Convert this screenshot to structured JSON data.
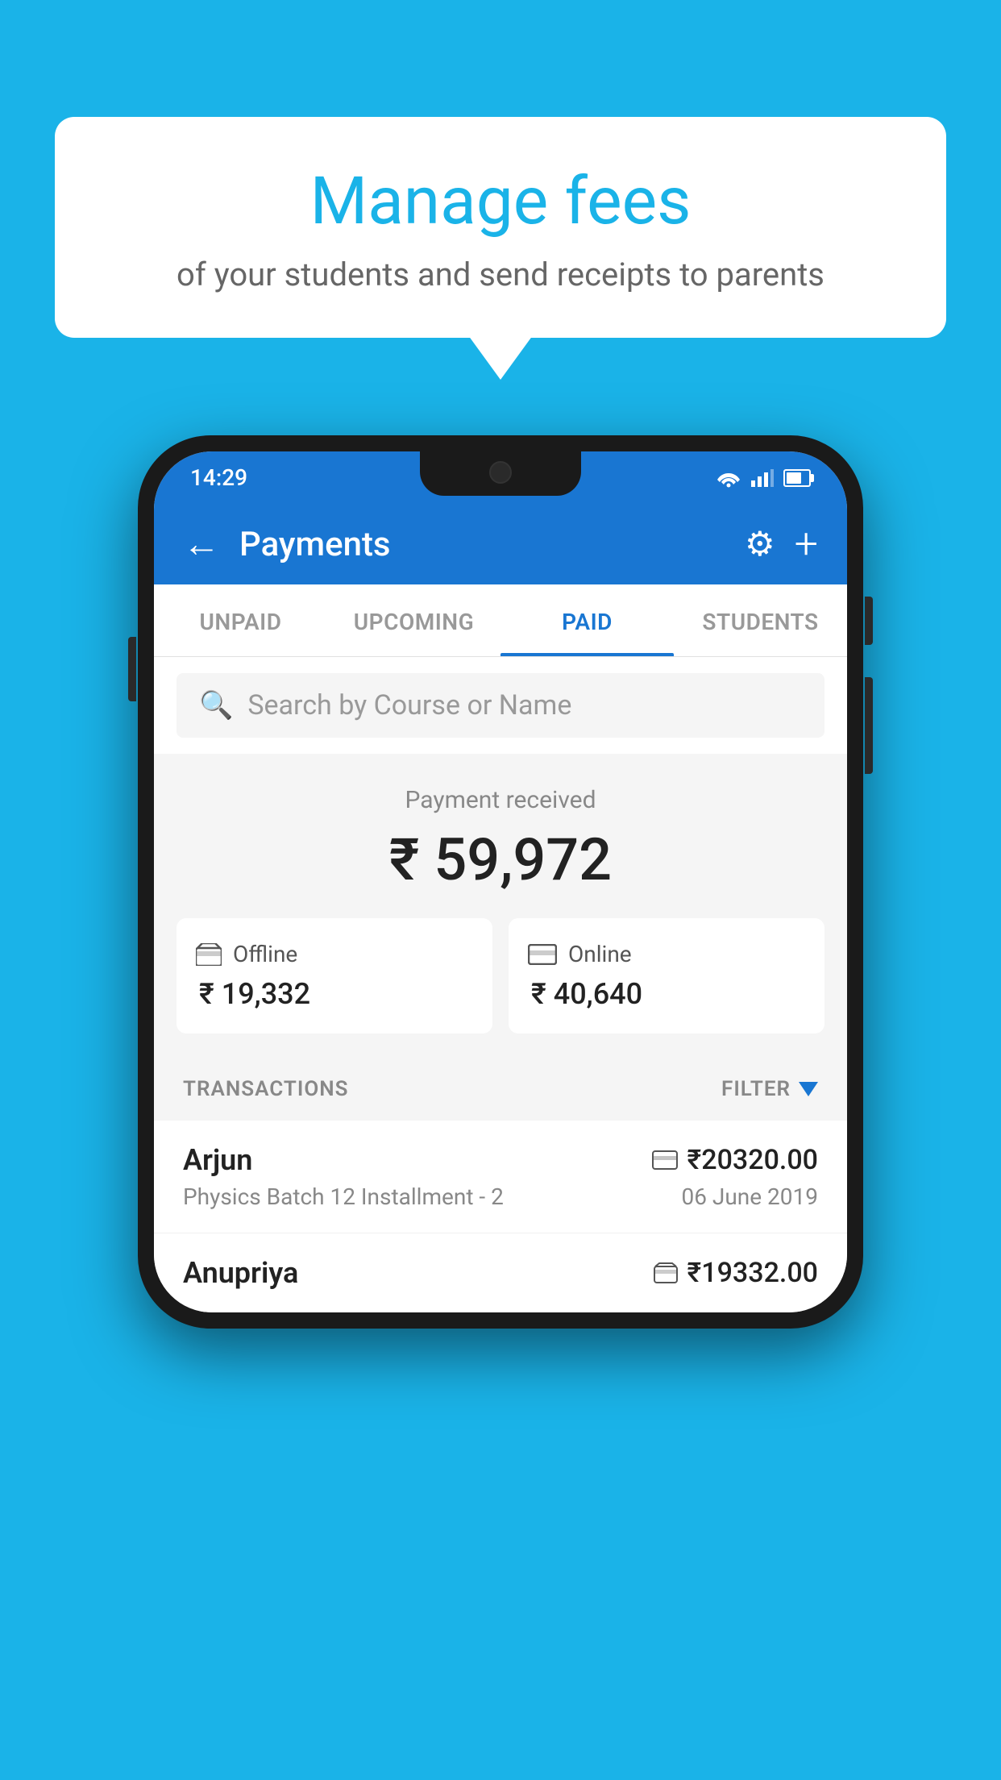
{
  "background_color": "#1ab3e8",
  "bubble": {
    "title": "Manage fees",
    "subtitle": "of your students and send receipts to parents"
  },
  "status_bar": {
    "time": "14:29",
    "wifi": "wifi",
    "signal": "signal",
    "battery": "battery"
  },
  "header": {
    "title": "Payments",
    "back_label": "←",
    "settings_label": "⚙",
    "add_label": "+"
  },
  "tabs": [
    {
      "label": "UNPAID",
      "active": false
    },
    {
      "label": "UPCOMING",
      "active": false
    },
    {
      "label": "PAID",
      "active": true
    },
    {
      "label": "STUDENTS",
      "active": false
    }
  ],
  "search": {
    "placeholder": "Search by Course or Name"
  },
  "payment_summary": {
    "label": "Payment received",
    "amount": "₹ 59,972",
    "offline": {
      "label": "Offline",
      "amount": "₹ 19,332"
    },
    "online": {
      "label": "Online",
      "amount": "₹ 40,640"
    }
  },
  "transactions": {
    "label": "TRANSACTIONS",
    "filter_label": "FILTER",
    "rows": [
      {
        "name": "Arjun",
        "course": "Physics Batch 12 Installment - 2",
        "amount": "₹20320.00",
        "date": "06 June 2019",
        "payment_type": "online"
      },
      {
        "name": "Anupriya",
        "course": "",
        "amount": "₹19332.00",
        "date": "",
        "payment_type": "offline"
      }
    ]
  }
}
